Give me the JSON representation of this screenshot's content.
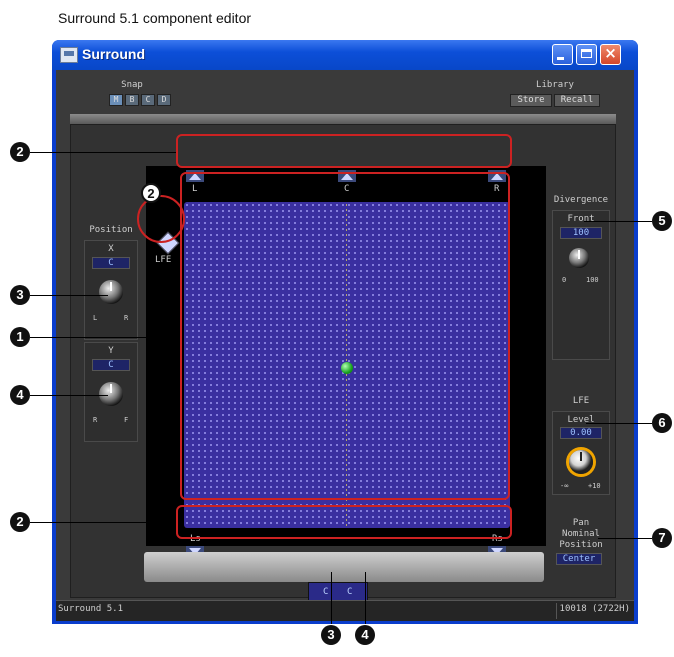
{
  "caption": "Surround 5.1 component editor",
  "window": {
    "title": "Surround"
  },
  "snap": {
    "label": "Snap",
    "buttons": [
      "M",
      "B",
      "C",
      "D"
    ]
  },
  "library": {
    "label": "Library",
    "store": "Store",
    "recall": "Recall"
  },
  "speakers": {
    "front": [
      "L",
      "C",
      "R"
    ],
    "rear": [
      "Ls",
      "Rs"
    ],
    "lfe": "LFE"
  },
  "position": {
    "title": "Position",
    "x": {
      "label": "X",
      "value": "C",
      "min_label": "L",
      "max_label": "R"
    },
    "y": {
      "label": "Y",
      "value": "C",
      "min_label": "R",
      "max_label": "F"
    }
  },
  "divergence": {
    "title": "Divergence",
    "front_label": "Front",
    "front_value": "100",
    "min_label": "0",
    "max_label": "100"
  },
  "lfe": {
    "title": "LFE",
    "level_label": "Level",
    "level_value": "0.00",
    "min_label": "-∞",
    "max_label": "+10"
  },
  "pan": {
    "label_line1": "Pan",
    "label_line2": "Nominal",
    "label_line3": "Position",
    "value": "Center"
  },
  "bottom_values": {
    "x": "C",
    "y": "C"
  },
  "status": {
    "left": "Surround   5.1",
    "right": "10018 (2722H)"
  },
  "callouts": {
    "n1": "1",
    "n2": "2",
    "n3": "3",
    "n4": "4",
    "n5": "5",
    "n6": "6",
    "n7": "7"
  }
}
